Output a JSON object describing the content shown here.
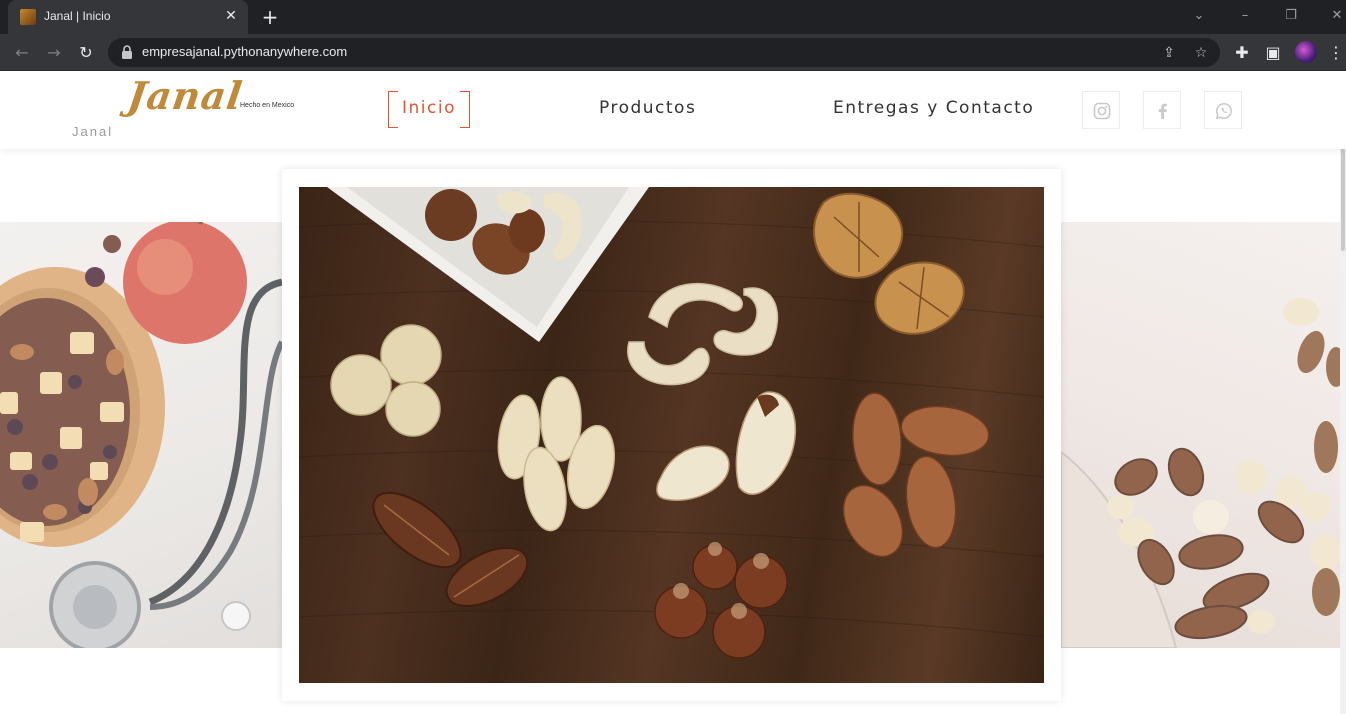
{
  "browser": {
    "tab_title": "Janal | Inicio",
    "tab_close": "✕",
    "new_tab": "+",
    "url": "empresajanal.pythonanywhere.com"
  },
  "site": {
    "logo_script": "Janal",
    "logo_tagline": "Hecho en Mexico",
    "logo_small": "Janal",
    "nav": {
      "home": "Inicio",
      "products": "Productos",
      "contact": "Entregas y Contacto"
    },
    "social": [
      "instagram-icon",
      "facebook-icon",
      "whatsapp-icon"
    ]
  },
  "colors": {
    "accent": "#e0572f",
    "logo": "#c08a3a",
    "chrome_dark": "#202124",
    "chrome_mid": "#35363a"
  }
}
